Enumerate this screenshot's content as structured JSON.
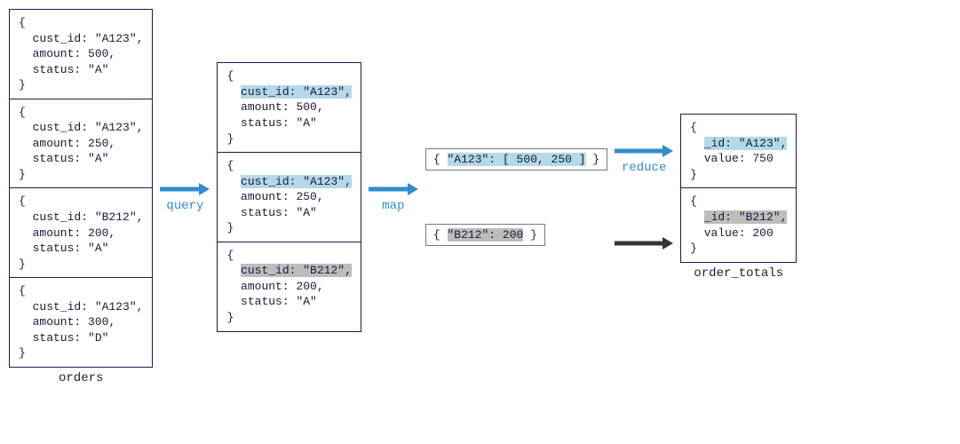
{
  "labels": {
    "orders": "orders",
    "order_totals": "order_totals",
    "query": "query",
    "map": "map",
    "reduce": "reduce"
  },
  "orders": [
    {
      "cust_id": "A123",
      "amount": 500,
      "status": "A"
    },
    {
      "cust_id": "A123",
      "amount": 250,
      "status": "A"
    },
    {
      "cust_id": "B212",
      "amount": 200,
      "status": "A"
    },
    {
      "cust_id": "A123",
      "amount": 300,
      "status": "D"
    }
  ],
  "queried": [
    {
      "cust_id": "A123",
      "amount": 500,
      "status": "A",
      "hl": "blue"
    },
    {
      "cust_id": "A123",
      "amount": 250,
      "status": "A",
      "hl": "blue"
    },
    {
      "cust_id": "B212",
      "amount": 200,
      "status": "A",
      "hl": "grey"
    }
  ],
  "mapped": [
    {
      "key": "A123",
      "values": "[ 500, 250 ]",
      "hl": "blue"
    },
    {
      "key": "B212",
      "values": "200",
      "hl": "grey"
    }
  ],
  "results": [
    {
      "_id": "A123",
      "value": 750,
      "hl": "blue"
    },
    {
      "_id": "B212",
      "value": 200,
      "hl": "grey"
    }
  ],
  "colors": {
    "arrow_blue": "#2f8ecb",
    "arrow_dark": "#333333"
  }
}
